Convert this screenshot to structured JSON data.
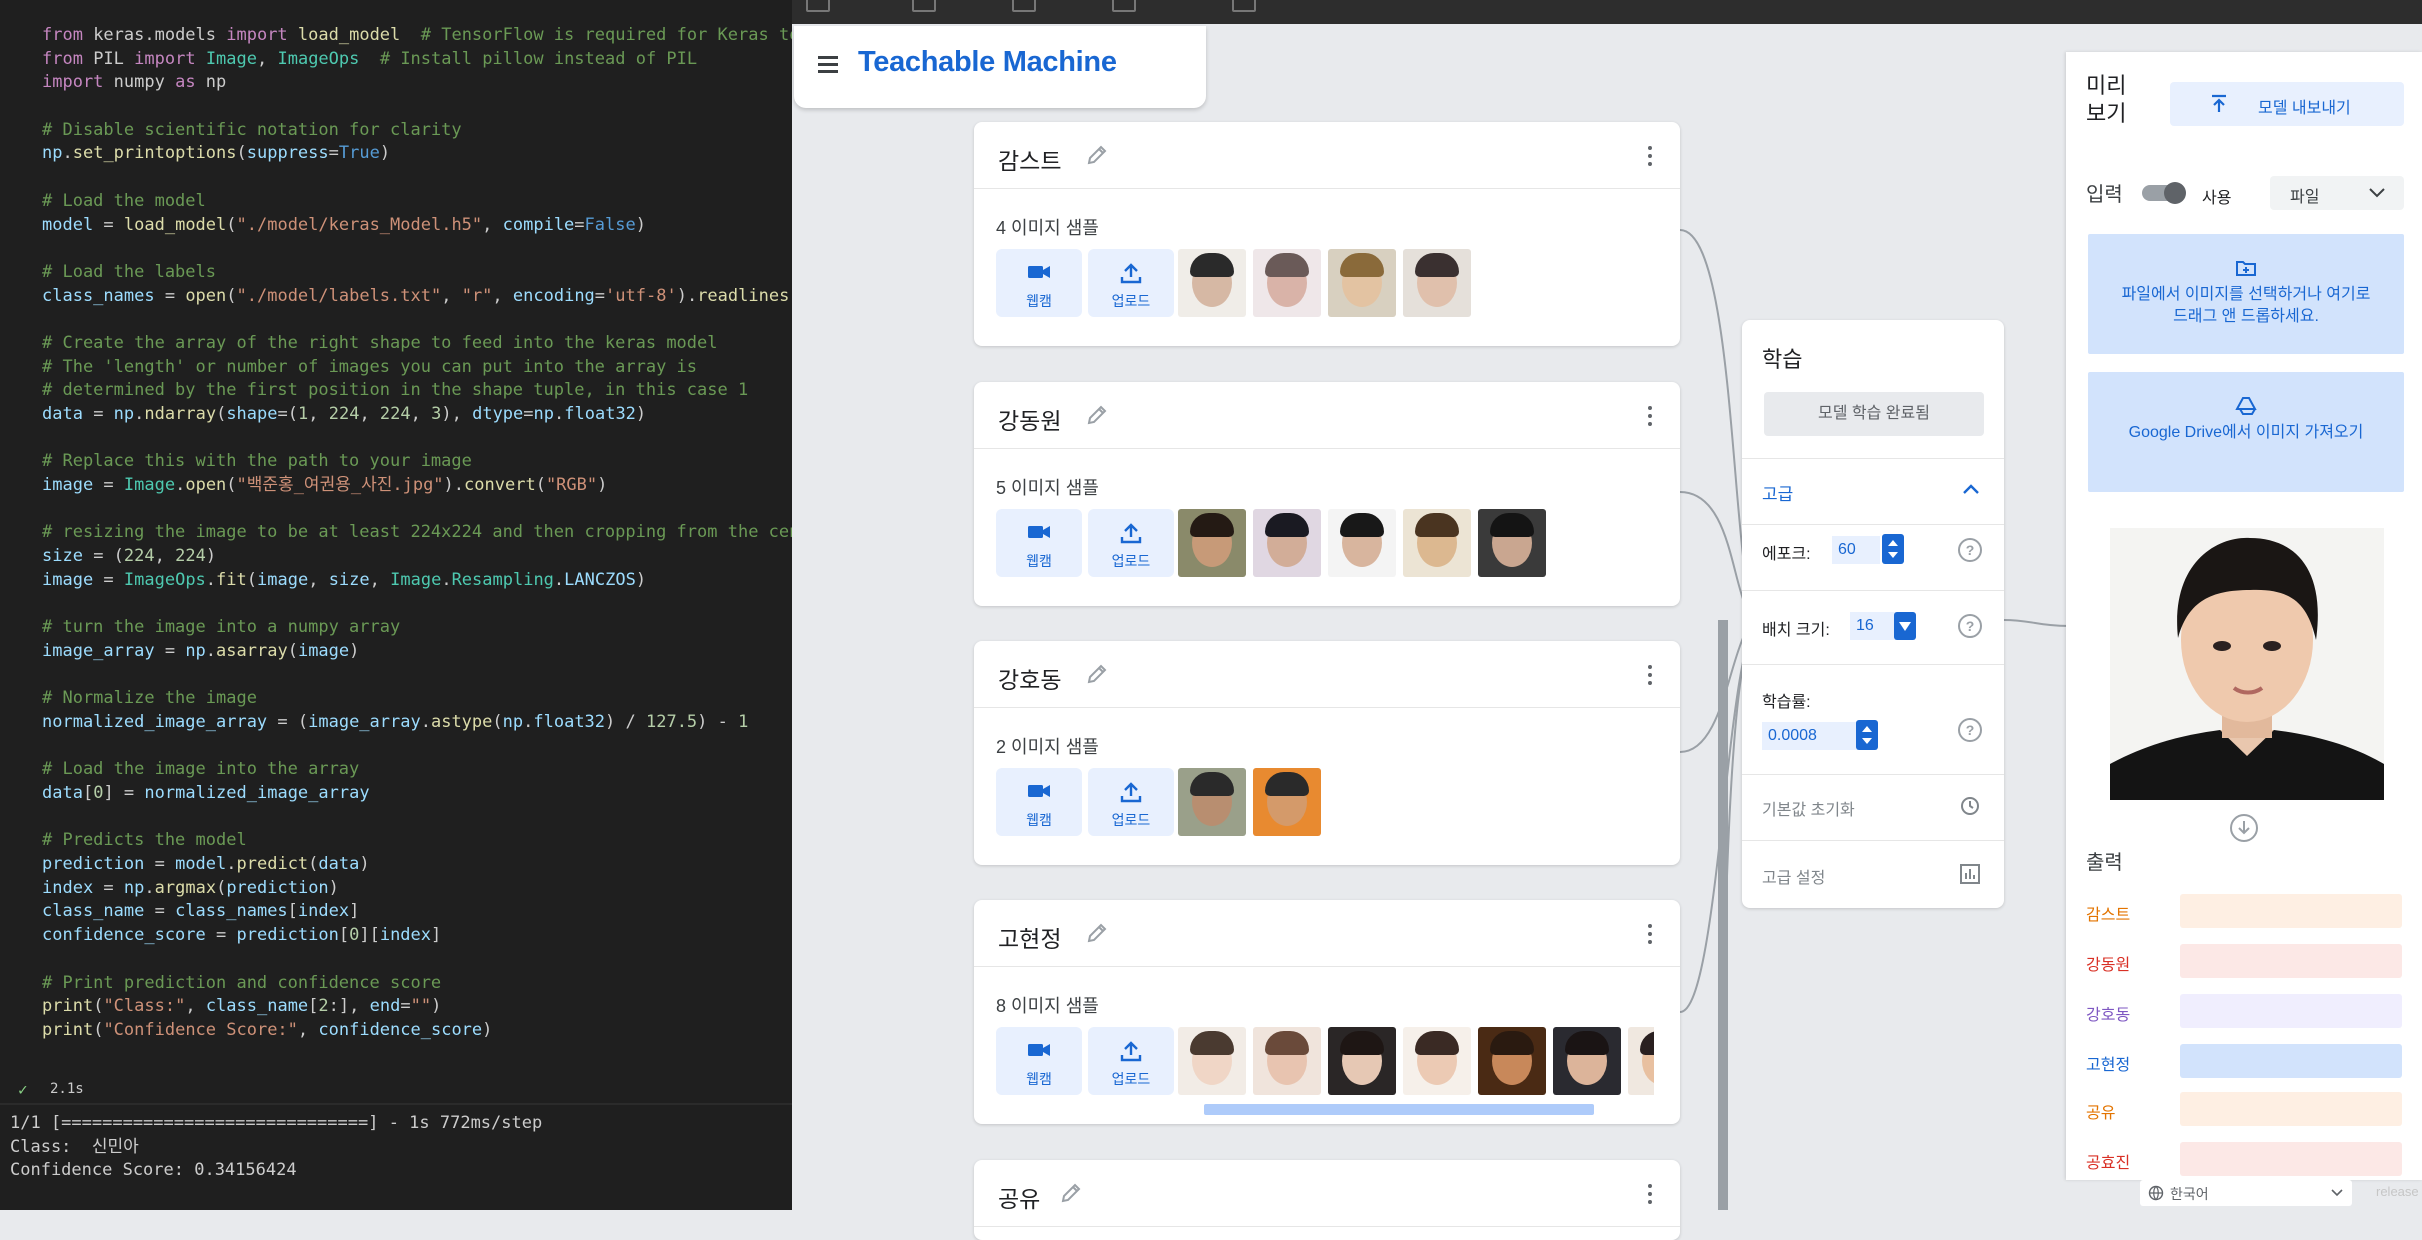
{
  "editor": {
    "code_lines": [
      [
        [
          "kw",
          "from"
        ],
        [
          "t",
          " keras.models "
        ],
        [
          "kw",
          "import"
        ],
        [
          "t",
          " "
        ],
        [
          "fn",
          "load_model"
        ],
        [
          "cm",
          "  # TensorFlow is required for Keras to wor"
        ]
      ],
      [
        [
          "kw",
          "from"
        ],
        [
          "t",
          " PIL "
        ],
        [
          "kw",
          "import"
        ],
        [
          "t",
          " "
        ],
        [
          "cls",
          "Image"
        ],
        [
          "t",
          ", "
        ],
        [
          "cls",
          "ImageOps"
        ],
        [
          "cm",
          "  # Install pillow instead of PIL"
        ]
      ],
      [
        [
          "kw",
          "import"
        ],
        [
          "t",
          " numpy "
        ],
        [
          "kw",
          "as"
        ],
        [
          "t",
          " np"
        ]
      ],
      [
        [
          "t",
          ""
        ]
      ],
      [
        [
          "cm",
          "# Disable scientific notation for clarity"
        ]
      ],
      [
        [
          "var",
          "np"
        ],
        [
          "t",
          "."
        ],
        [
          "fn",
          "set_printoptions"
        ],
        [
          "t",
          "("
        ],
        [
          "var",
          "suppress"
        ],
        [
          "t",
          "="
        ],
        [
          "bl",
          "True"
        ],
        [
          "t",
          ")"
        ]
      ],
      [
        [
          "t",
          ""
        ]
      ],
      [
        [
          "cm",
          "# Load the model"
        ]
      ],
      [
        [
          "var",
          "model"
        ],
        [
          "t",
          " = "
        ],
        [
          "fn",
          "load_model"
        ],
        [
          "t",
          "("
        ],
        [
          "str",
          "\"./model/keras_Model.h5\""
        ],
        [
          "t",
          ", "
        ],
        [
          "var",
          "compile"
        ],
        [
          "t",
          "="
        ],
        [
          "bl",
          "False"
        ],
        [
          "t",
          ")"
        ]
      ],
      [
        [
          "t",
          ""
        ]
      ],
      [
        [
          "cm",
          "# Load the labels"
        ]
      ],
      [
        [
          "var",
          "class_names"
        ],
        [
          "t",
          " = "
        ],
        [
          "fn",
          "open"
        ],
        [
          "t",
          "("
        ],
        [
          "str",
          "\"./model/labels.txt\""
        ],
        [
          "t",
          ", "
        ],
        [
          "str",
          "\"r\""
        ],
        [
          "t",
          ", "
        ],
        [
          "var",
          "encoding"
        ],
        [
          "t",
          "="
        ],
        [
          "str",
          "'utf-8'"
        ],
        [
          "t",
          ")."
        ],
        [
          "fn",
          "readlines"
        ],
        [
          "t",
          "()"
        ]
      ],
      [
        [
          "t",
          ""
        ]
      ],
      [
        [
          "cm",
          "# Create the array of the right shape to feed into the keras model"
        ]
      ],
      [
        [
          "cm",
          "# The 'length' or number of images you can put into the array is"
        ]
      ],
      [
        [
          "cm",
          "# determined by the first position in the shape tuple, in this case 1"
        ]
      ],
      [
        [
          "var",
          "data"
        ],
        [
          "t",
          " = "
        ],
        [
          "var",
          "np"
        ],
        [
          "t",
          "."
        ],
        [
          "fn",
          "ndarray"
        ],
        [
          "t",
          "("
        ],
        [
          "var",
          "shape"
        ],
        [
          "t",
          "=("
        ],
        [
          "num",
          "1"
        ],
        [
          "t",
          ", "
        ],
        [
          "num",
          "224"
        ],
        [
          "t",
          ", "
        ],
        [
          "num",
          "224"
        ],
        [
          "t",
          ", "
        ],
        [
          "num",
          "3"
        ],
        [
          "t",
          "), "
        ],
        [
          "var",
          "dtype"
        ],
        [
          "t",
          "="
        ],
        [
          "var",
          "np"
        ],
        [
          "t",
          "."
        ],
        [
          "var",
          "float32"
        ],
        [
          "t",
          ")"
        ]
      ],
      [
        [
          "t",
          ""
        ]
      ],
      [
        [
          "cm",
          "# Replace this with the path to your image"
        ]
      ],
      [
        [
          "var",
          "image"
        ],
        [
          "t",
          " = "
        ],
        [
          "cls",
          "Image"
        ],
        [
          "t",
          "."
        ],
        [
          "fn",
          "open"
        ],
        [
          "t",
          "("
        ],
        [
          "str",
          "\"백준홍_여권용_사진.jpg\""
        ],
        [
          "t",
          ")."
        ],
        [
          "fn",
          "convert"
        ],
        [
          "t",
          "("
        ],
        [
          "str",
          "\"RGB\""
        ],
        [
          "t",
          ")"
        ]
      ],
      [
        [
          "t",
          ""
        ]
      ],
      [
        [
          "cm",
          "# resizing the image to be at least 224x224 and then cropping from the center"
        ]
      ],
      [
        [
          "var",
          "size"
        ],
        [
          "t",
          " = ("
        ],
        [
          "num",
          "224"
        ],
        [
          "t",
          ", "
        ],
        [
          "num",
          "224"
        ],
        [
          "t",
          ")"
        ]
      ],
      [
        [
          "var",
          "image"
        ],
        [
          "t",
          " = "
        ],
        [
          "cls",
          "ImageOps"
        ],
        [
          "t",
          "."
        ],
        [
          "fn",
          "fit"
        ],
        [
          "t",
          "("
        ],
        [
          "var",
          "image"
        ],
        [
          "t",
          ", "
        ],
        [
          "var",
          "size"
        ],
        [
          "t",
          ", "
        ],
        [
          "cls",
          "Image"
        ],
        [
          "t",
          "."
        ],
        [
          "cls",
          "Resampling"
        ],
        [
          "t",
          "."
        ],
        [
          "var",
          "LANCZOS"
        ],
        [
          "t",
          ")"
        ]
      ],
      [
        [
          "t",
          ""
        ]
      ],
      [
        [
          "cm",
          "# turn the image into a numpy array"
        ]
      ],
      [
        [
          "var",
          "image_array"
        ],
        [
          "t",
          " = "
        ],
        [
          "var",
          "np"
        ],
        [
          "t",
          "."
        ],
        [
          "fn",
          "asarray"
        ],
        [
          "t",
          "("
        ],
        [
          "var",
          "image"
        ],
        [
          "t",
          ")"
        ]
      ],
      [
        [
          "t",
          ""
        ]
      ],
      [
        [
          "cm",
          "# Normalize the image"
        ]
      ],
      [
        [
          "var",
          "normalized_image_array"
        ],
        [
          "t",
          " = ("
        ],
        [
          "var",
          "image_array"
        ],
        [
          "t",
          "."
        ],
        [
          "fn",
          "astype"
        ],
        [
          "t",
          "("
        ],
        [
          "var",
          "np"
        ],
        [
          "t",
          "."
        ],
        [
          "var",
          "float32"
        ],
        [
          "t",
          ") / "
        ],
        [
          "num",
          "127.5"
        ],
        [
          "t",
          ") - "
        ],
        [
          "num",
          "1"
        ]
      ],
      [
        [
          "t",
          ""
        ]
      ],
      [
        [
          "cm",
          "# Load the image into the array"
        ]
      ],
      [
        [
          "var",
          "data"
        ],
        [
          "t",
          "["
        ],
        [
          "num",
          "0"
        ],
        [
          "t",
          "] = "
        ],
        [
          "var",
          "normalized_image_array"
        ]
      ],
      [
        [
          "t",
          ""
        ]
      ],
      [
        [
          "cm",
          "# Predicts the model"
        ]
      ],
      [
        [
          "var",
          "prediction"
        ],
        [
          "t",
          " = "
        ],
        [
          "var",
          "model"
        ],
        [
          "t",
          "."
        ],
        [
          "fn",
          "predict"
        ],
        [
          "t",
          "("
        ],
        [
          "var",
          "data"
        ],
        [
          "t",
          ")"
        ]
      ],
      [
        [
          "var",
          "index"
        ],
        [
          "t",
          " = "
        ],
        [
          "var",
          "np"
        ],
        [
          "t",
          "."
        ],
        [
          "fn",
          "argmax"
        ],
        [
          "t",
          "("
        ],
        [
          "var",
          "prediction"
        ],
        [
          "t",
          ")"
        ]
      ],
      [
        [
          "var",
          "class_name"
        ],
        [
          "t",
          " = "
        ],
        [
          "var",
          "class_names"
        ],
        [
          "t",
          "["
        ],
        [
          "var",
          "index"
        ],
        [
          "t",
          "]"
        ]
      ],
      [
        [
          "var",
          "confidence_score"
        ],
        [
          "t",
          " = "
        ],
        [
          "var",
          "prediction"
        ],
        [
          "t",
          "["
        ],
        [
          "num",
          "0"
        ],
        [
          "t",
          "]["
        ],
        [
          "var",
          "index"
        ],
        [
          "t",
          "]"
        ]
      ],
      [
        [
          "t",
          ""
        ]
      ],
      [
        [
          "cm",
          "# Print prediction and confidence score"
        ]
      ],
      [
        [
          "fn",
          "print"
        ],
        [
          "t",
          "("
        ],
        [
          "str",
          "\"Class:\""
        ],
        [
          "t",
          ", "
        ],
        [
          "var",
          "class_name"
        ],
        [
          "t",
          "["
        ],
        [
          "num",
          "2"
        ],
        [
          "t",
          ":], "
        ],
        [
          "var",
          "end"
        ],
        [
          "t",
          "="
        ],
        [
          "str",
          "\"\""
        ],
        [
          "t",
          ")"
        ]
      ],
      [
        [
          "fn",
          "print"
        ],
        [
          "t",
          "("
        ],
        [
          "str",
          "\"Confidence Score:\""
        ],
        [
          "t",
          ", "
        ],
        [
          "var",
          "confidence_score"
        ],
        [
          "t",
          ")"
        ]
      ]
    ],
    "exec_time": "2.1s",
    "output_lines": [
      "1/1 [==============================] - 1s 772ms/step",
      "Class:  신민아",
      "Confidence Score: 0.34156424"
    ]
  },
  "app": {
    "title": "Teachable Machine"
  },
  "classes": [
    {
      "name": "감스트",
      "samples": "4 이미지 샘플",
      "thumb_colors": [
        [
          "#d6b8a4",
          "#2a2a2a",
          "#f0ede8"
        ],
        [
          "#d9b3a8",
          "#6a5a58",
          "#efe7e9"
        ],
        [
          "#e3c3a2",
          "#8a6a3a",
          "#d8d0c0"
        ],
        [
          "#e0c0ac",
          "#3a3030",
          "#e5e0da"
        ]
      ]
    },
    {
      "name": "강동원",
      "samples": "5 이미지 샘플",
      "thumb_colors": [
        [
          "#c79a78",
          "#241a14",
          "#8a8a6a"
        ],
        [
          "#d2ad98",
          "#1a1a22",
          "#e0d7e2"
        ],
        [
          "#d8b59e",
          "#181818",
          "#f4f4f4"
        ],
        [
          "#dcb890",
          "#4a3420",
          "#ece4d4"
        ],
        [
          "#c9a690",
          "#141414",
          "#3a3a3a"
        ]
      ]
    },
    {
      "name": "강호동",
      "samples": "2 이미지 샘플",
      "thumb_colors": [
        [
          "#b88e70",
          "#2a2a2a",
          "#9aa08a"
        ],
        [
          "#d49a6a",
          "#2a2a2a",
          "#e88a30"
        ]
      ]
    },
    {
      "name": "고현정",
      "samples": "8 이미지 샘플",
      "thumb_colors": [
        [
          "#f0d6c6",
          "#4a3a30",
          "#f2ece6"
        ],
        [
          "#e8c4b0",
          "#6a4a3a",
          "#f0e4dc"
        ],
        [
          "#e6c8b4",
          "#1e1614",
          "#2a2626"
        ],
        [
          "#eccab4",
          "#3a2a24",
          "#f6f0ea"
        ],
        [
          "#c8885a",
          "#2a1a10",
          "#4a2a14"
        ],
        [
          "#dcb49a",
          "#1a1414",
          "#2a2a30"
        ],
        [
          "#e8c0a0",
          "#2a2020",
          "#f0e8e0"
        ]
      ]
    },
    {
      "name": "공유",
      "samples": "",
      "thumb_colors": []
    }
  ],
  "buttons": {
    "webcam": "웹캠",
    "upload": "업로드"
  },
  "training": {
    "title": "학습",
    "train_button": "모델 학습 완료됨",
    "advanced": "고급",
    "epochs_label": "에포크:",
    "epochs_value": "60",
    "batch_label": "배치 크기:",
    "batch_value": "16",
    "lr_label": "학습률:",
    "lr_value": "0.0008",
    "reset": "기본값 초기화",
    "settings": "고급 설정",
    "help_glyph": "?"
  },
  "preview": {
    "title": "미리\n보기",
    "export": "모델 내보내기",
    "input_label": "입력",
    "toggle_label": "사용",
    "source": "파일",
    "drop_text": "파일에서 이미지를 선택하거나 여기로 드래그 앤 드롭하세요.",
    "drive_text": "Google Drive에서 이미지 가져오기",
    "output_label": "출력",
    "outputs": [
      {
        "name": "감스트",
        "color": "#e37400",
        "bar": "#feefe3"
      },
      {
        "name": "강동원",
        "color": "#d93025",
        "bar": "#fce8e6"
      },
      {
        "name": "강호동",
        "color": "#7e57c2",
        "bar": "#f0eefe"
      },
      {
        "name": "고현정",
        "color": "#1967d2",
        "bar": "#d2e3fc"
      },
      {
        "name": "공유",
        "color": "#e37400",
        "bar": "#feefe3"
      },
      {
        "name": "공효진",
        "color": "#d93025",
        "bar": "#fce8e6"
      }
    ]
  },
  "footer": {
    "language": "한국어",
    "release": "release"
  }
}
